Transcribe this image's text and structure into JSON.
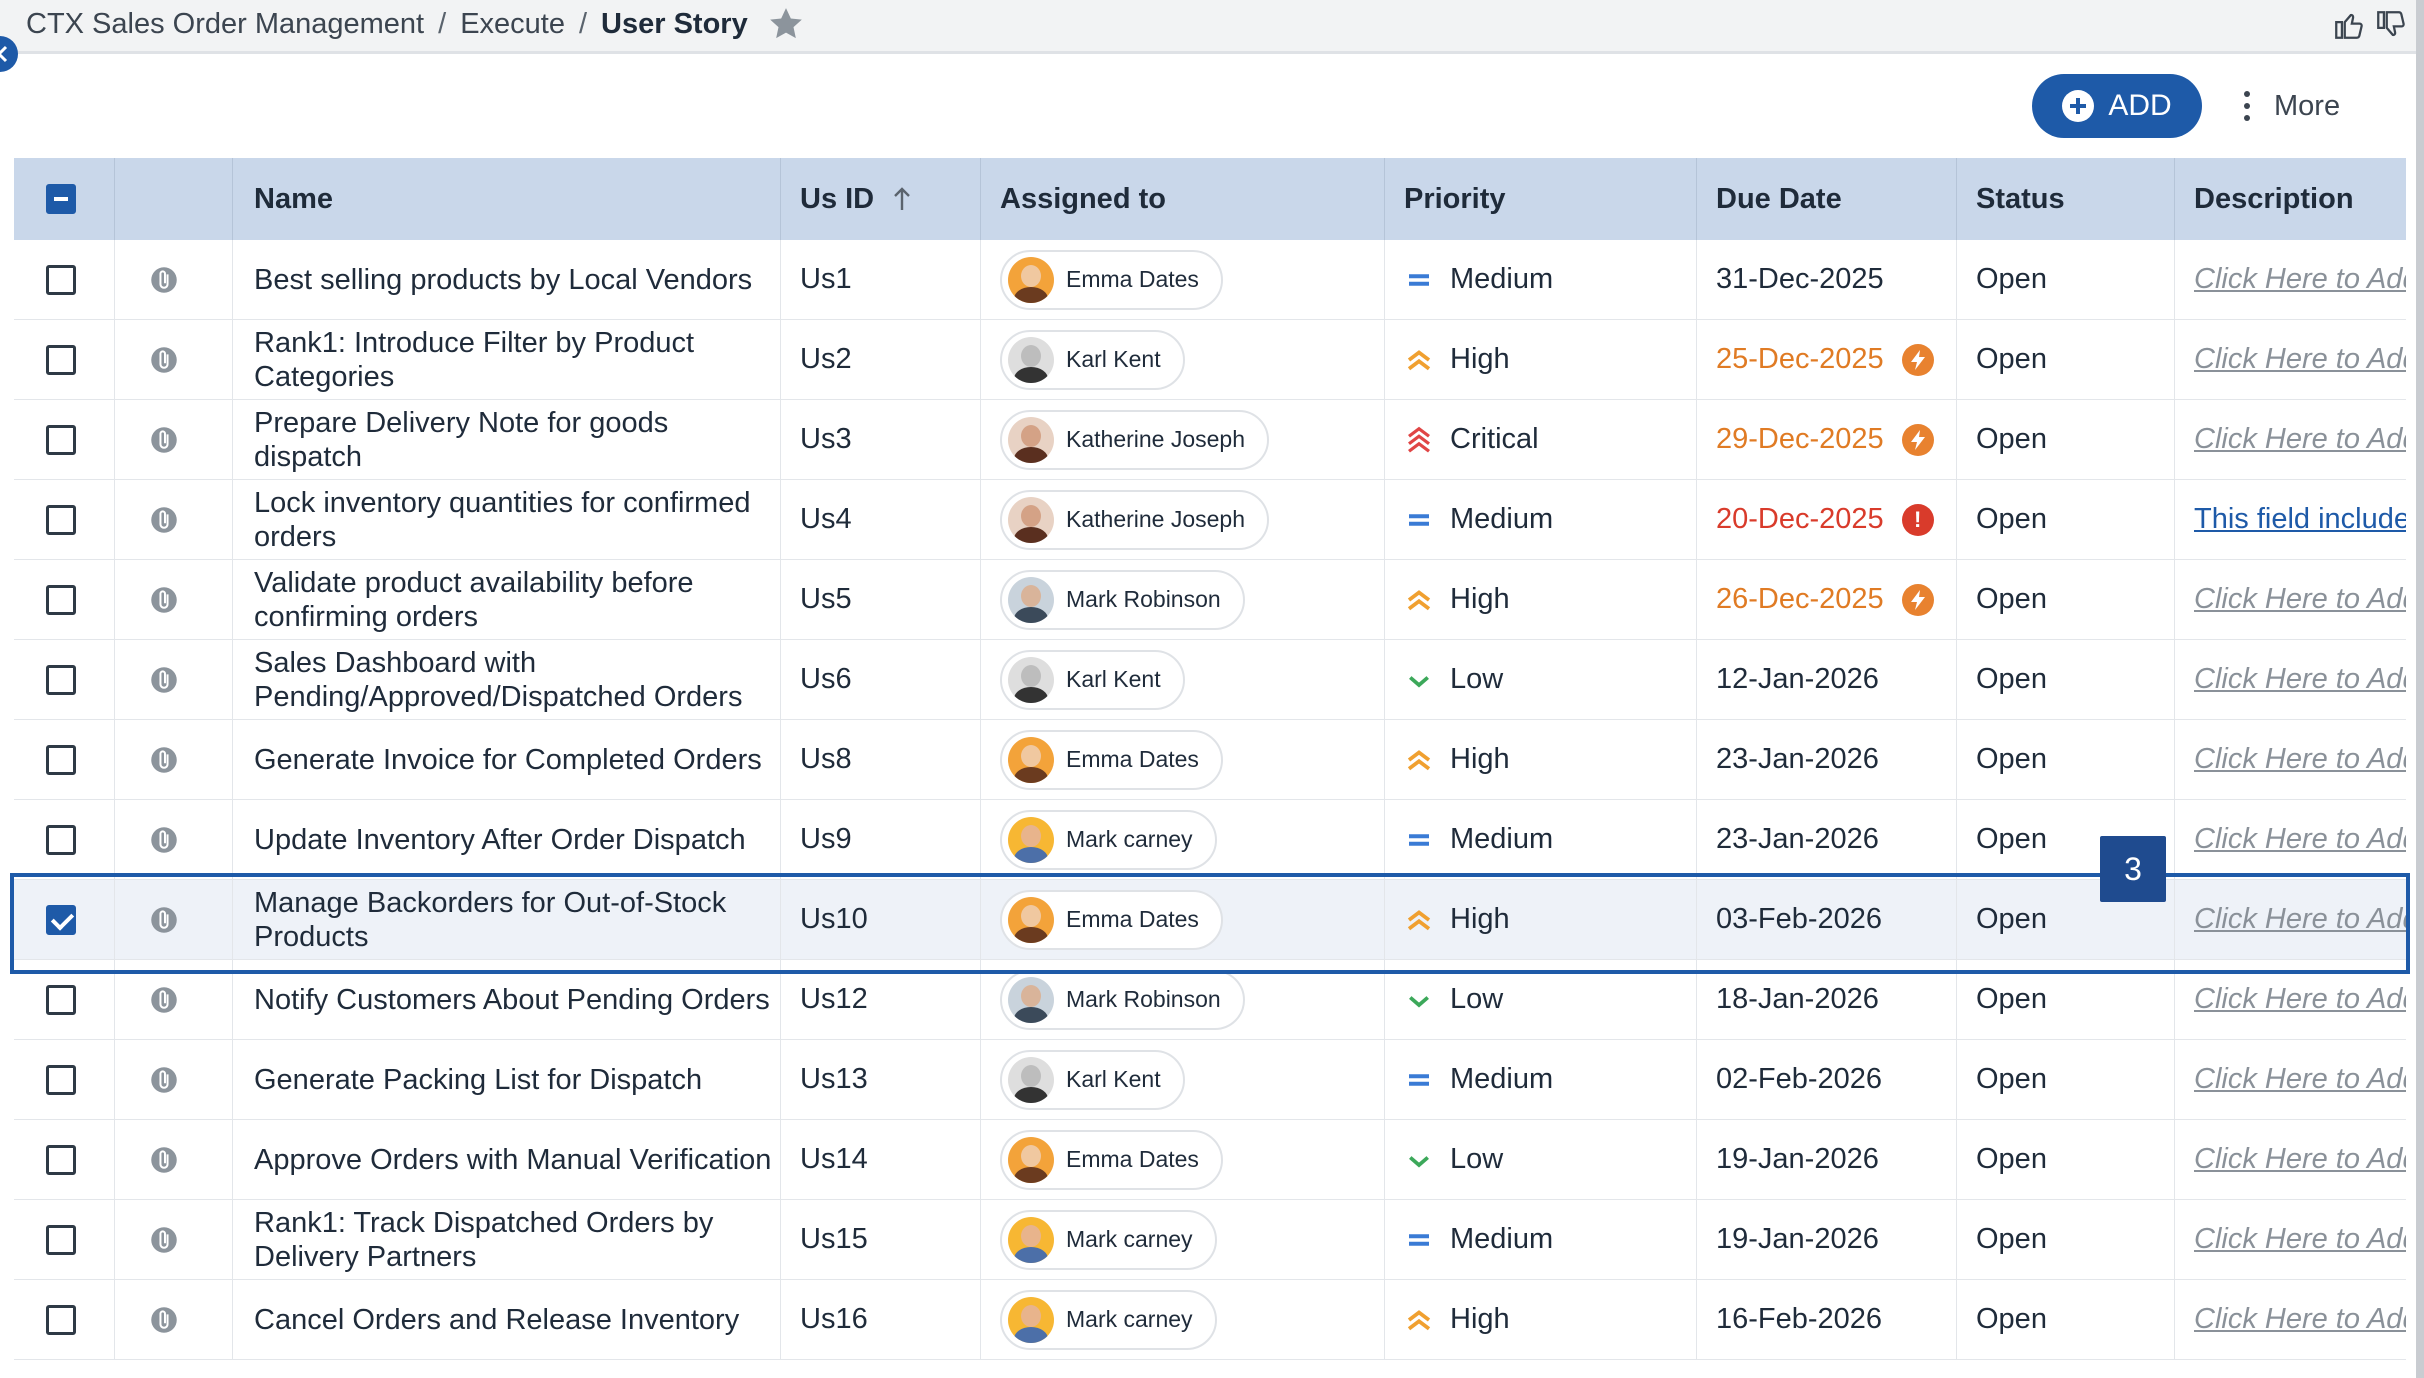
{
  "breadcrumb": {
    "items": [
      "CTX Sales Order Management",
      "Execute"
    ],
    "current": "User Story",
    "separator": "/"
  },
  "toolbar": {
    "add_label": "ADD",
    "more_label": "More"
  },
  "columns": {
    "name": "Name",
    "usid": "Us ID",
    "assigned": "Assigned to",
    "priority": "Priority",
    "due": "Due Date",
    "status": "Status",
    "description": "Description"
  },
  "rows": [
    {
      "name": "Best selling products by Local Vendors",
      "usid": "Us1",
      "assignee": "Emma Dates",
      "priority": "Medium",
      "due": "31-Dec-2025",
      "status": "Open",
      "description": "Click Here to Add"
    },
    {
      "name": "Rank1: Introduce Filter by Product Categories",
      "usid": "Us2",
      "assignee": "Karl Kent",
      "priority": "High",
      "due": "25-Dec-2025",
      "status": "Open",
      "description": "Click Here to Add"
    },
    {
      "name": "Prepare Delivery Note for goods dispatch",
      "usid": "Us3",
      "assignee": "Katherine Joseph",
      "priority": "Critical",
      "due": "29-Dec-2025",
      "status": "Open",
      "description": "Click Here to Add"
    },
    {
      "name": "Lock inventory quantities for confirmed orders",
      "usid": "Us4",
      "assignee": "Katherine Joseph",
      "priority": "Medium",
      "due": "20-Dec-2025",
      "status": "Open",
      "description": "This field includes"
    },
    {
      "name": "Validate product availability before confirming orders",
      "usid": "Us5",
      "assignee": "Mark Robinson",
      "priority": "High",
      "due": "26-Dec-2025",
      "status": "Open",
      "description": "Click Here to Add"
    },
    {
      "name": "Sales Dashboard with Pending/Approved/Dispatched Orders",
      "usid": "Us6",
      "assignee": "Karl Kent",
      "priority": "Low",
      "due": "12-Jan-2026",
      "status": "Open",
      "description": "Click Here to Add"
    },
    {
      "name": "Generate Invoice for Completed Orders",
      "usid": "Us8",
      "assignee": "Emma Dates",
      "priority": "High",
      "due": "23-Jan-2026",
      "status": "Open",
      "description": "Click Here to Add"
    },
    {
      "name": "Update Inventory After Order Dispatch",
      "usid": "Us9",
      "assignee": "Mark carney",
      "priority": "Medium",
      "due": "23-Jan-2026",
      "status": "Open",
      "description": "Click Here to Add"
    },
    {
      "name": "Manage Backorders for Out-of-Stock Products",
      "usid": "Us10",
      "assignee": "Emma Dates",
      "priority": "High",
      "due": "03-Feb-2026",
      "status": "Open",
      "description": "Click Here to Add"
    },
    {
      "name": "Notify Customers About Pending Orders",
      "usid": "Us12",
      "assignee": "Mark Robinson",
      "priority": "Low",
      "due": "18-Jan-2026",
      "status": "Open",
      "description": "Click Here to Add"
    },
    {
      "name": "Generate Packing List for Dispatch",
      "usid": "Us13",
      "assignee": "Karl Kent",
      "priority": "Medium",
      "due": "02-Feb-2026",
      "status": "Open",
      "description": "Click Here to Add"
    },
    {
      "name": "Approve Orders with Manual Verification",
      "usid": "Us14",
      "assignee": "Emma Dates",
      "priority": "Low",
      "due": "19-Jan-2026",
      "status": "Open",
      "description": "Click Here to Add"
    },
    {
      "name": "Rank1: Track Dispatched Orders by Delivery Partners",
      "usid": "Us15",
      "assignee": "Mark carney",
      "priority": "Medium",
      "due": "19-Jan-2026",
      "status": "Open",
      "description": "Click Here to Add"
    },
    {
      "name": "Cancel Orders and Release Inventory",
      "usid": "Us16",
      "assignee": "Mark carney",
      "priority": "High",
      "due": "16-Feb-2026",
      "status": "Open",
      "description": "Click Here to Add"
    }
  ],
  "selected_badge": "3",
  "colors": {
    "accent": "#1e5aa8",
    "header_bg": "#c9d7ea",
    "warning": "#e07b24",
    "overdue": "#d93b2b",
    "medium": "#3a7bd5",
    "high": "#f0a030",
    "critical": "#e04545",
    "low": "#3ca85a"
  }
}
